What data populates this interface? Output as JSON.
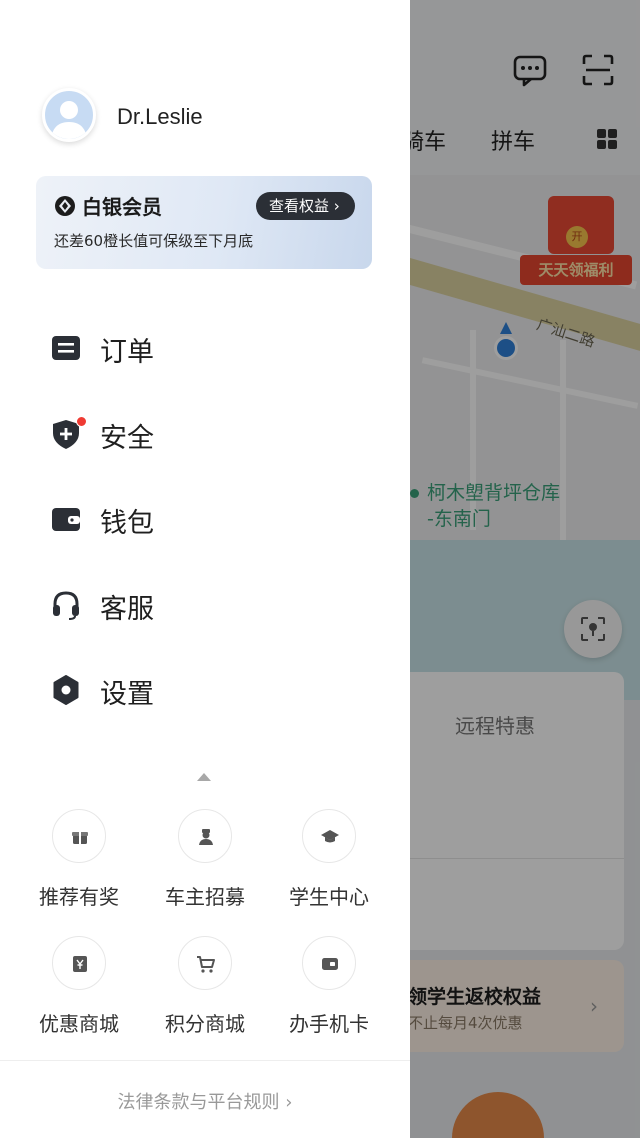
{
  "background": {
    "tabs": [
      "骑车",
      "拼车"
    ],
    "promo": {
      "badge_text": "天天领福利",
      "coin_text": "开"
    },
    "map": {
      "road_label": "广汕二路",
      "poi_label_line1": "柯木塱背坪仓库",
      "poi_label_line2": "-东南门"
    },
    "card1": {
      "title": "远程特惠"
    },
    "card2": {
      "title": "领学生返校权益",
      "subtitle": "不止每月4次优惠"
    }
  },
  "drawer": {
    "profile": {
      "name": "Dr.Leslie"
    },
    "member": {
      "title": "白银会员",
      "button": "查看权益 ›",
      "subtitle": "还差60橙长值可保级至下月底"
    },
    "menu": [
      {
        "label": "订单",
        "icon": "order-icon"
      },
      {
        "label": "安全",
        "icon": "shield-plus-icon",
        "badge": true
      },
      {
        "label": "钱包",
        "icon": "wallet-icon"
      },
      {
        "label": "客服",
        "icon": "headset-icon"
      },
      {
        "label": "设置",
        "icon": "gear-icon"
      }
    ],
    "shortcuts": [
      {
        "label": "推荐有奖",
        "icon": "gift-icon"
      },
      {
        "label": "车主招募",
        "icon": "driver-icon"
      },
      {
        "label": "学生中心",
        "icon": "graduation-cap-icon"
      },
      {
        "label": "优惠商城",
        "icon": "yen-icon"
      },
      {
        "label": "积分商城",
        "icon": "cart-icon"
      },
      {
        "label": "办手机卡",
        "icon": "sim-card-icon"
      }
    ],
    "footer": "法律条款与平台规则 ›"
  },
  "colors": {
    "accent_dark": "#2b2f36",
    "badge_red": "#ef3b33",
    "member_gradient_start": "#eef2f8",
    "member_gradient_end": "#c8d7ec"
  }
}
